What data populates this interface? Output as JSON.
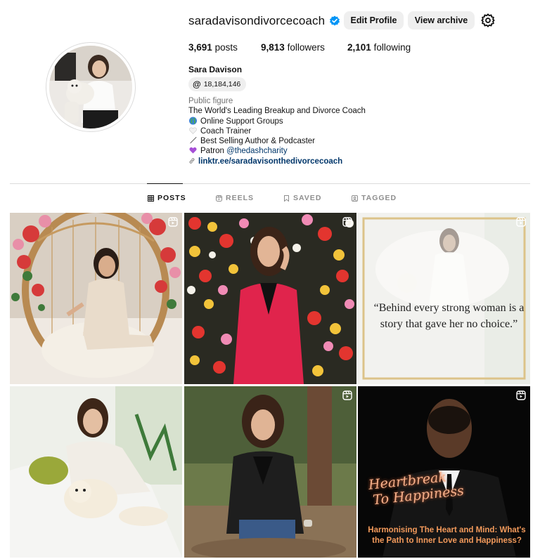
{
  "profile": {
    "username": "saradavisondivorcecoach",
    "edit_profile_label": "Edit Profile",
    "view_archive_label": "View archive",
    "settings_icon": "gear-icon",
    "verified_icon": "verified-badge-icon",
    "posts": "3,691",
    "posts_label": "posts",
    "followers": "9,813",
    "followers_label": "followers",
    "following": "2,101",
    "following_label": "following",
    "full_name": "Sara Davison",
    "threads_count": "18,184,146",
    "threads_icon": "threads-icon"
  },
  "bio": {
    "category": "Public figure",
    "line1": "The World's Leading Breakup and Divorce Coach",
    "line2_emoji": "globe-emoji",
    "line2": "Online Support Groups",
    "line3_emoji": "white-heart-emoji",
    "line3": "Coach Trainer",
    "line4_emoji": "pen-emoji",
    "line4": "Best Selling Author & Podcaster",
    "line5_emoji": "purple-heart-emoji",
    "line5_prefix": "Patron",
    "line5_mention": "@thedashcharity",
    "link_icon": "link-icon",
    "link": "linktr.ee/saradavisonthedivorcecoach"
  },
  "tabs": [
    {
      "label": "POSTS",
      "icon": "grid-icon",
      "active": true
    },
    {
      "label": "REELS",
      "icon": "reels-icon",
      "active": false
    },
    {
      "label": "SAVED",
      "icon": "bookmark-icon",
      "active": false
    },
    {
      "label": "TAGGED",
      "icon": "tagged-icon",
      "active": false
    }
  ],
  "posts": [
    {
      "kind": "reel",
      "alt": "woman-in-egg-chair"
    },
    {
      "kind": "reel",
      "alt": "woman-red-blazer-flower-wall"
    },
    {
      "kind": "reel",
      "quote": "“Behind every strong woman is a story that gave her no choice.”"
    },
    {
      "kind": "photo",
      "alt": "woman-with-dog-on-chair"
    },
    {
      "kind": "reel",
      "alt": "woman-black-blazer-outdoors"
    },
    {
      "kind": "reel",
      "title_line1": "Heartbreak",
      "title_line2": "To Happiness",
      "subtitle": "Harmonising The Heart and Mind: What's the Path to Inner Love and Happiness?"
    }
  ],
  "colors": {
    "link_blue": "#00376b",
    "verified_blue": "#0095f6",
    "button_grey": "#efefef",
    "muted_text": "#737373"
  }
}
